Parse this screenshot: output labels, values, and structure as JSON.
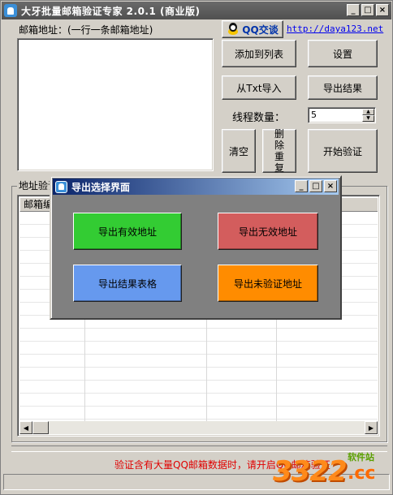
{
  "app": {
    "title": "大牙批量邮箱验证专家 2.0.1 (商业版)",
    "caption_buttons": {
      "minimize": "_",
      "maximize": "□",
      "close": "×"
    }
  },
  "email_label": "邮箱地址：(一行一条邮箱地址)",
  "email_input_value": "",
  "qq_button_label": "QQ交谈",
  "website_link": "http://daya123.net",
  "buttons": {
    "add_to_list": "添加到列表",
    "settings": "设置",
    "import_txt": "从Txt导入",
    "export_results": "导出结果",
    "clear": "清空",
    "dedupe": "删除重复",
    "start": "开始验证"
  },
  "thread_label": "线程数量：",
  "thread_value": "5",
  "group_label": "地址验证",
  "grid": {
    "columns": [
      "邮箱编"
    ]
  },
  "notice_text": "验证含有大量QQ邮箱数据时，请开启QQ邮箱验证",
  "watermark": {
    "number": "3322",
    "suffix": ".cc",
    "tag": "软件站"
  },
  "dialog": {
    "title": "导出选择界面",
    "buttons": {
      "valid": "导出有效地址",
      "invalid": "导出无效地址",
      "table": "导出结果表格",
      "unverified": "导出未验证地址"
    },
    "colors": {
      "valid": "#33cc33",
      "invalid": "#d35d5d",
      "table": "#6699ee",
      "unverified": "#ff8c00"
    }
  }
}
